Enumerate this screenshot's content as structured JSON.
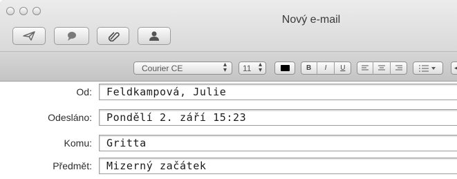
{
  "window": {
    "title": "Nový e-mail"
  },
  "toolbar": {
    "buttons": [
      {
        "name": "send",
        "icon": "paper-plane-icon"
      },
      {
        "name": "reply",
        "icon": "speech-bubble-icon"
      },
      {
        "name": "attach",
        "icon": "paperclip-icon"
      },
      {
        "name": "address-book",
        "icon": "person-icon"
      }
    ]
  },
  "format_bar": {
    "font": "Courier CE",
    "size": "11",
    "style_buttons": [
      "B",
      "I",
      "U"
    ],
    "list_icon": "list-icon"
  },
  "fields": {
    "from": {
      "label": "Od:",
      "value": "Feldkampová, Julie"
    },
    "sent": {
      "label": "Odesláno:",
      "value": "Pondělí 2. září 15:23"
    },
    "to": {
      "label": "Komu:",
      "value": "Gritta"
    },
    "subject": {
      "label": "Předmět:",
      "value": "Mizerný začátek"
    }
  }
}
